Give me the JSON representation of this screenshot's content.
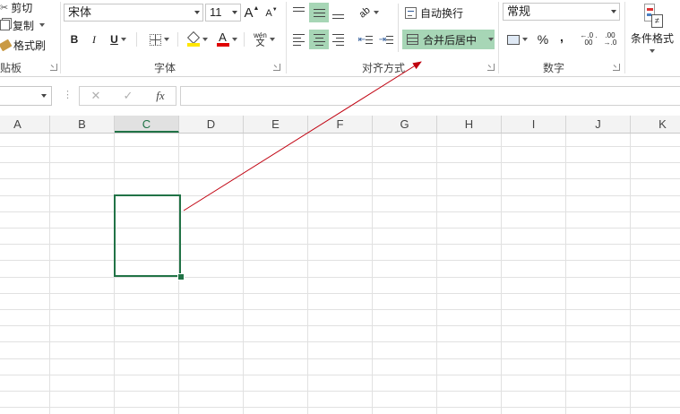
{
  "clipboard": {
    "cut": "剪切",
    "copy": "复制",
    "format_painter": "格式刷",
    "group": "粘贴板"
  },
  "font": {
    "name": "宋体",
    "size": "11",
    "bold": "B",
    "italic": "I",
    "underline": "U",
    "grow": "A",
    "shrink": "A",
    "font_color_glyph": "A",
    "phonetic_top": "wén",
    "phonetic_bottom": "文",
    "group": "字体"
  },
  "alignment": {
    "wrap_text": "自动换行",
    "merge_center": "合并后居中",
    "group": "对齐方式"
  },
  "number": {
    "format": "常规",
    "percent": "%",
    "comma": ",",
    "inc_decimal": "←.0 .00",
    "dec_decimal": ".00 →.0",
    "group": "数字"
  },
  "styles": {
    "conditional_format": "条件格式"
  },
  "formula_bar": {
    "name_box": "",
    "cancel": "✕",
    "enter": "✓",
    "fx": "fx",
    "formula": ""
  },
  "columns": [
    "A",
    "B",
    "C",
    "D",
    "E",
    "F",
    "G",
    "H",
    "I",
    "J",
    "K"
  ],
  "active_column": "C",
  "colors": {
    "accent": "#217346",
    "selected_btn": "#a7d6b6",
    "arrow": "#c0000f",
    "highlight": "#ffe600",
    "font_color": "#e00000"
  }
}
